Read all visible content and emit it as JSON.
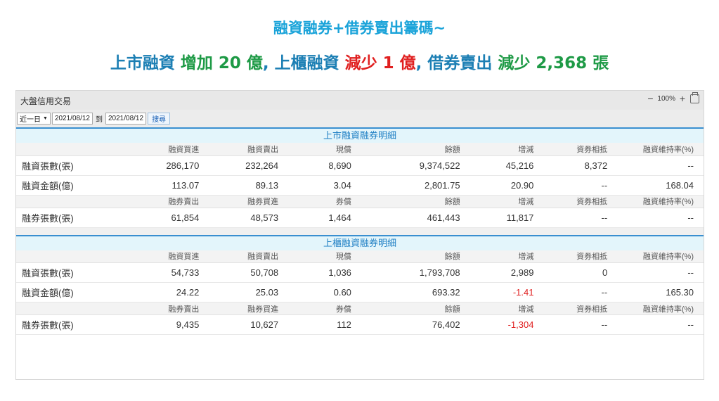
{
  "headline": {
    "line1": "融資融券+借券賣出籌碼~",
    "line2": {
      "p1": "上市融資",
      "p2": "增加 20 億",
      "p3": ", 上櫃融資",
      "p4": "減少 1 億",
      "p5": ", 借券賣出",
      "p6": "減少 2,368 張"
    },
    "colors": {
      "cyan": "#1aa3d9",
      "blue": "#1c7fb4",
      "green": "#1e9a46",
      "red": "#e02020"
    }
  },
  "panel": {
    "title": "大盤信用交易",
    "zoom": "100%",
    "icons": [
      "minus-icon",
      "plus-icon",
      "print-icon"
    ]
  },
  "filter": {
    "period": "近一日",
    "start_date": "2021/08/12",
    "to_label": "到",
    "end_date": "2021/08/12",
    "query_label": "搜尋"
  },
  "listed": {
    "title": "上市融資融券明細",
    "margin_header": [
      "融資買進",
      "融資賣出",
      "現償",
      "餘額",
      "增減",
      "資券相抵",
      "融資維持率(%)"
    ],
    "rows": [
      {
        "label": "融資張數(張)",
        "values": [
          "286,170",
          "232,264",
          "8,690",
          "9,374,522",
          "45,216",
          "8,372",
          "--"
        ]
      },
      {
        "label": "融資金額(億)",
        "values": [
          "113.07",
          "89.13",
          "3.04",
          "2,801.75",
          "20.90",
          "--",
          "168.04"
        ]
      }
    ],
    "short_header": [
      "融券賣出",
      "融券買進",
      "券償",
      "餘額",
      "增減",
      "資券相抵",
      "融資維持率(%)"
    ],
    "short_rows": [
      {
        "label": "融券張數(張)",
        "values": [
          "61,854",
          "48,573",
          "1,464",
          "461,443",
          "11,817",
          "--",
          "--"
        ]
      }
    ]
  },
  "otc": {
    "title": "上櫃融資融券明細",
    "margin_header": [
      "融資買進",
      "融資賣出",
      "現償",
      "餘額",
      "增減",
      "資券相抵",
      "融資維持率(%)"
    ],
    "rows": [
      {
        "label": "融資張數(張)",
        "values": [
          "54,733",
          "50,708",
          "1,036",
          "1,793,708",
          "2,989",
          "0",
          "--"
        ]
      },
      {
        "label": "融資金額(億)",
        "values": [
          "24.22",
          "25.03",
          "0.60",
          "693.32",
          "-1.41",
          "--",
          "165.30"
        ]
      }
    ],
    "short_header": [
      "融券賣出",
      "融券買進",
      "券償",
      "餘額",
      "增減",
      "資券相抵",
      "融資維持率(%)"
    ],
    "short_rows": [
      {
        "label": "融券張數(張)",
        "values": [
          "9,435",
          "10,627",
          "112",
          "76,402",
          "-1,304",
          "--",
          "--"
        ]
      }
    ]
  }
}
